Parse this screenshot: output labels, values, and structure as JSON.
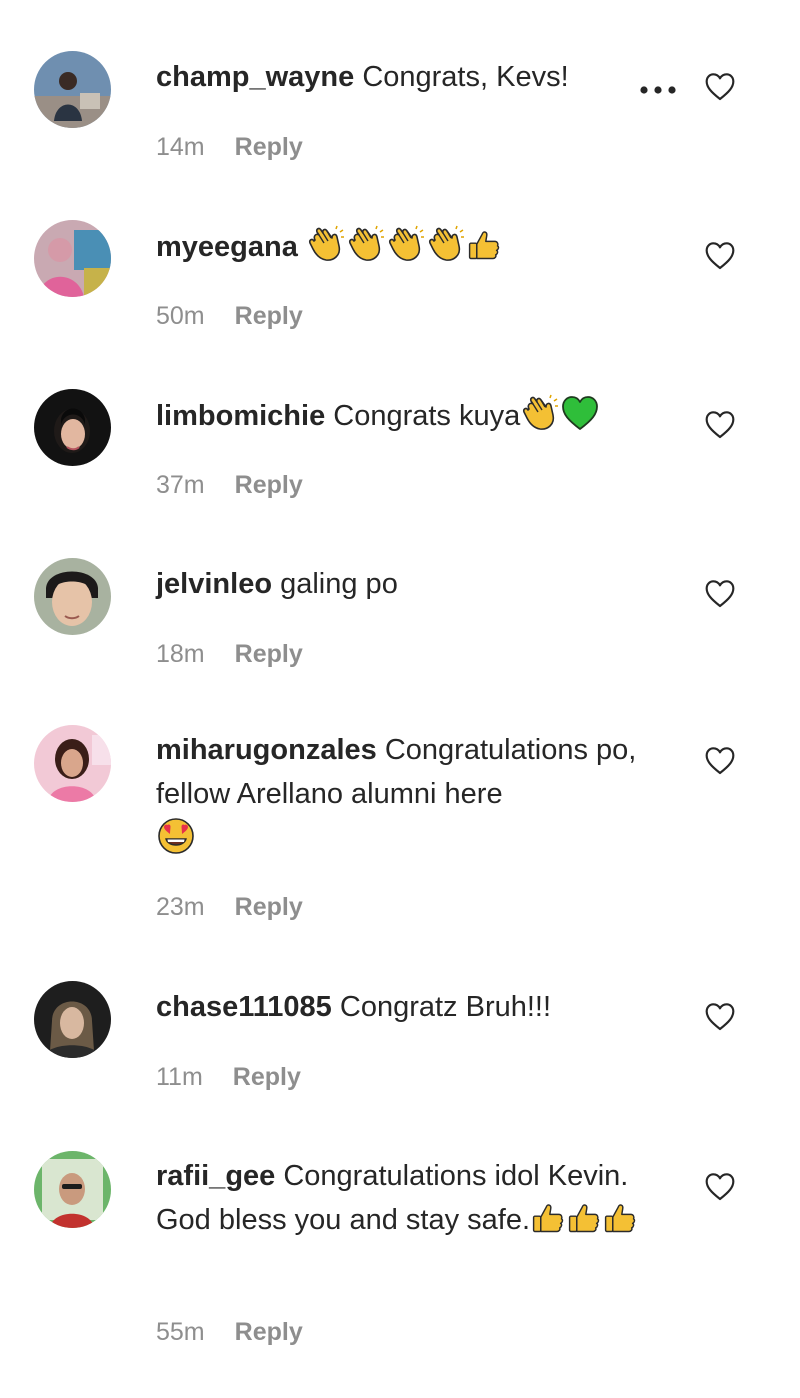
{
  "comments": [
    {
      "username": "champ_wayne",
      "text": " Congrats, Kevs!",
      "time": "14m",
      "reply": "Reply"
    },
    {
      "username": "myeegana",
      "text": " ",
      "time": "50m",
      "reply": "Reply"
    },
    {
      "username": "limbomichie",
      "text": " Congrats kuya",
      "time": "37m",
      "reply": "Reply"
    },
    {
      "username": "jelvinleo",
      "text": " galing po",
      "time": "18m",
      "reply": "Reply"
    },
    {
      "username": "miharugonzales",
      "text": " Congratulations po, fellow Arellano alumni here",
      "time": "23m",
      "reply": "Reply"
    },
    {
      "username": "chase111085",
      "text": " Congratz Bruh!!!",
      "time": "11m",
      "reply": "Reply"
    },
    {
      "username": "rafii_gee",
      "text": " Congratulations idol Kevin. God bless you and stay safe.",
      "time": "55m",
      "reply": "Reply"
    }
  ],
  "icons": {
    "heart": "heart-outline-icon",
    "more": "more-options-icon",
    "clap": "clapping-hands-emoji",
    "thumbs": "thumbs-up-emoji",
    "green_heart": "green-heart-emoji",
    "heart_eyes": "heart-eyes-emoji"
  },
  "colors": {
    "text": "#262626",
    "meta": "#8e8e8e"
  }
}
